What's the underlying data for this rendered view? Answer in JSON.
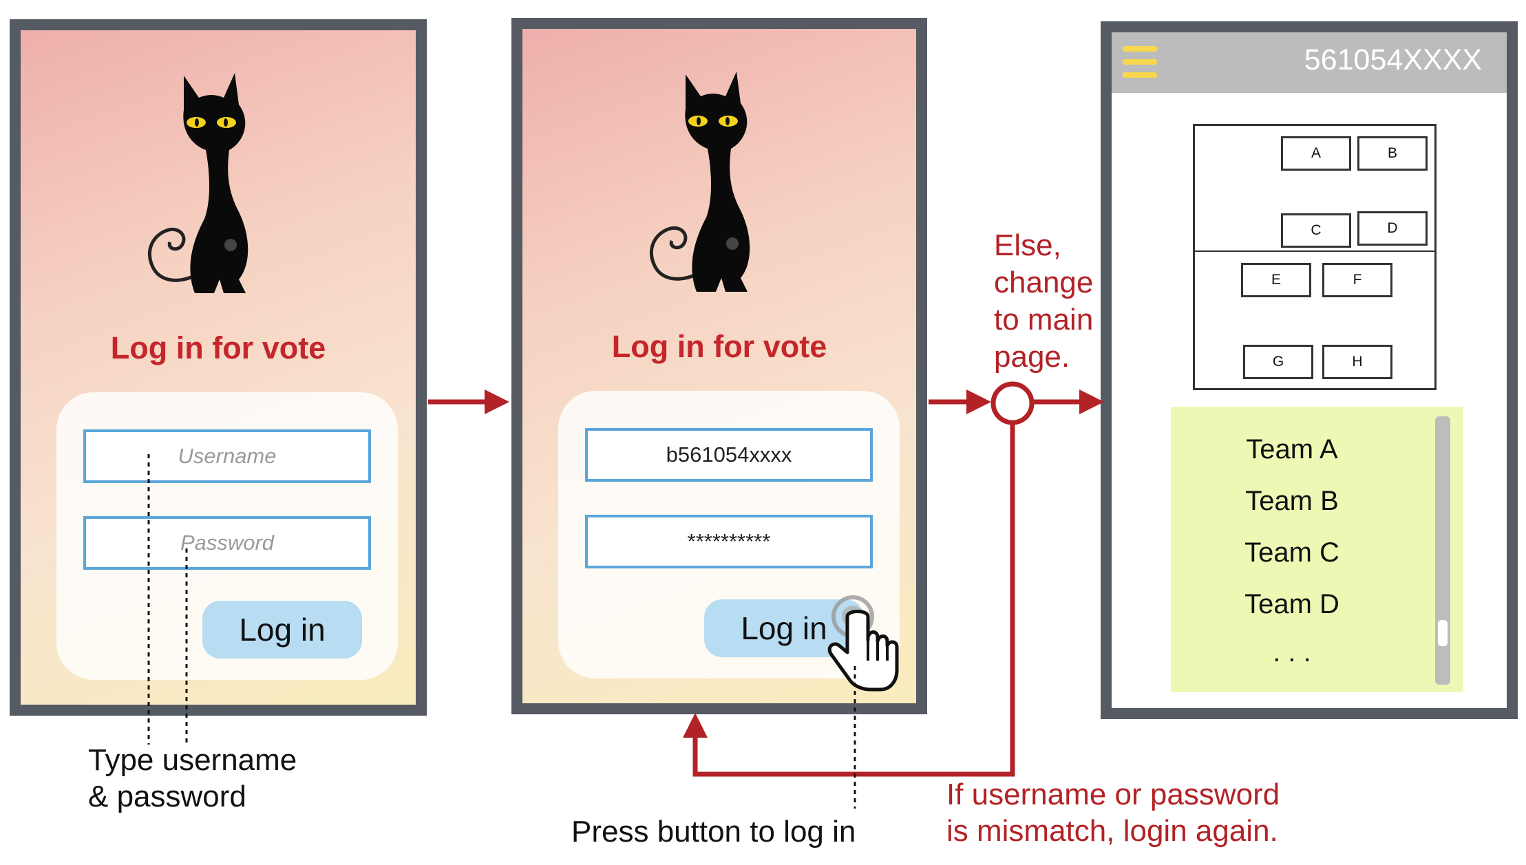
{
  "screen1": {
    "title": "Log in for vote",
    "username_placeholder": "Username",
    "password_placeholder": "Password",
    "login_button": "Log in"
  },
  "screen2": {
    "title": "Log in for vote",
    "username_value": "b561054xxxx",
    "password_value": "**********",
    "login_button": "Log in"
  },
  "screen3": {
    "user_id": "561054XXXX",
    "seats": [
      "A",
      "B",
      "C",
      "D",
      "E",
      "F",
      "G",
      "H"
    ],
    "teams": [
      "Team A",
      "Team B",
      "Team C",
      "Team D",
      ". . ."
    ]
  },
  "annotations": {
    "type_line1": "Type username",
    "type_line2": "& password",
    "press": "Press button to log in",
    "else_line1": "Else,",
    "else_line2": "change",
    "else_line3": "to main",
    "else_line4": "page.",
    "mismatch_line1": "If username or password",
    "mismatch_line2": "is mismatch, login again."
  },
  "colors": {
    "accent_red": "#b32226",
    "title_red": "#c4262b",
    "frame": "#555a63",
    "field_border": "#5aa6da",
    "button": "#b8dcf2",
    "team_panel": "#eef8b4",
    "menu_icon": "#f7d84d"
  }
}
